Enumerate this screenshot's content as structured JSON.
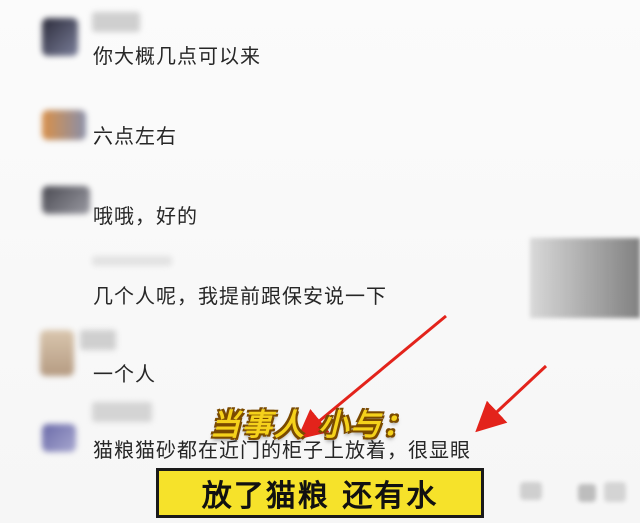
{
  "messages": [
    {
      "id": "m1",
      "text": "你大概几点可以来"
    },
    {
      "id": "m2",
      "text": "六点左右"
    },
    {
      "id": "m3",
      "text": "哦哦，好的"
    },
    {
      "id": "m4",
      "text": "几个人呢，我提前跟保安说一下"
    },
    {
      "id": "m5",
      "text": "一个人"
    },
    {
      "id": "m6",
      "text": "猫粮猫砂都在近门的柜子上放着，很显眼"
    }
  ],
  "captions": {
    "speaker": "当事人 小与：",
    "subtitle": "放了猫粮 还有水"
  },
  "colors": {
    "arrow": "#e3231b",
    "caption_yellow": "#f6e22a"
  }
}
